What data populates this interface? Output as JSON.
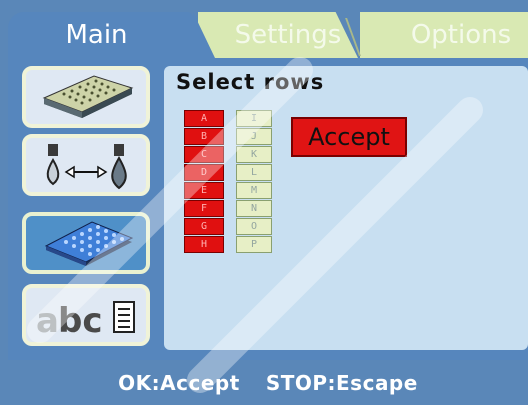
{
  "tabs": [
    {
      "label": "Main",
      "active": true
    },
    {
      "label": "Settings",
      "active": false
    },
    {
      "label": "Options",
      "active": false
    }
  ],
  "sidebar": {
    "items": [
      {
        "name": "plates",
        "icon": "microplate-stack-icon",
        "active": false
      },
      {
        "name": "dispense",
        "icon": "droplet-transfer-icon",
        "active": false
      },
      {
        "name": "plate-selection",
        "icon": "selected-plate-icon",
        "active": true
      },
      {
        "name": "text",
        "icon": "abc-document-icon",
        "active": false
      }
    ]
  },
  "content": {
    "title": "Select rows",
    "rows_left": [
      "A",
      "B",
      "C",
      "D",
      "E",
      "F",
      "G",
      "H"
    ],
    "rows_right": [
      "I",
      "J",
      "K",
      "L",
      "M",
      "N",
      "O",
      "P"
    ],
    "accept_label": "Accept"
  },
  "status_bar": {
    "ok_hint": "OK:Accept",
    "stop_hint": "STOP:Escape"
  },
  "colors": {
    "panel": "#5686bd",
    "content_bg": "#c8dff1",
    "selected_row": "#e01010",
    "unselected_row": "#e7efc6",
    "inactive_tab": "#d9e9b3"
  }
}
